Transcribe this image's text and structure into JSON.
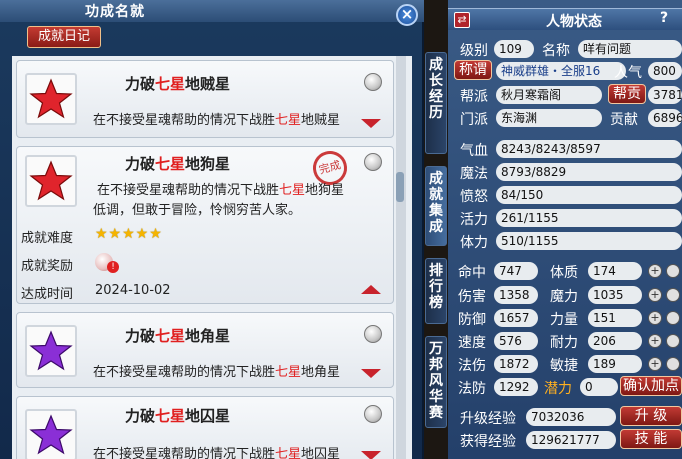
{
  "left_panel": {
    "title": "功成名就",
    "diary_button": "成就日记",
    "achievements": [
      {
        "title_pre": "力破",
        "title_red": "七星",
        "title_post": "地贼星",
        "desc_pre": "在不接受星魂帮助的情况下战胜",
        "desc_red": "七星",
        "desc_post": "地贼星",
        "star_color": "#e0242c"
      },
      {
        "title_pre": "力破",
        "title_red": "七星",
        "title_post": "地狗星",
        "desc_line1_pre": "在不接受星魂帮助的情况下战胜",
        "desc_line1_red": "七星",
        "desc_line1_post": "地狗星",
        "desc_line2": "低调，但敢于冒险，怜悯穷苦人家。",
        "difficulty_label": "成就难度",
        "difficulty_stars": "★★★★★",
        "reward_label": "成就奖励",
        "reward_badge": "!",
        "date_label": "达成时间",
        "date_value": "2024-10-02",
        "star_color": "#e0242c",
        "seal_text": "完成"
      },
      {
        "title_pre": "力破",
        "title_red": "七星",
        "title_post": "地角星",
        "desc_pre": "在不接受星魂帮助的情况下战胜",
        "desc_red": "七星",
        "desc_post": "地角星",
        "star_color": "#8a2fd6"
      },
      {
        "title_pre": "力破",
        "title_red": "七星",
        "title_post": "地囚星",
        "desc_pre": "在不接受星魂帮助的情况下战胜",
        "desc_red": "七星",
        "desc_post": "地囚星",
        "star_color": "#8a2fd6"
      }
    ]
  },
  "side_tabs": [
    "成长经历",
    "成就集成",
    "排行榜",
    "万邦风华赛"
  ],
  "right_panel": {
    "title": "人物状态",
    "help": "?",
    "level_label": "级别",
    "level": "109",
    "name_label": "名称",
    "name": "咩有问题",
    "title_button": "称谓",
    "title_value": "神威群雄・全服16",
    "renqi_label": "人气",
    "renqi": "800",
    "guild_label": "帮派",
    "guild": "秋月寒霜阁",
    "guild_contrib_button": "帮贡",
    "guild_contrib": "3781",
    "sect_label": "门派",
    "sect": "东海渊",
    "contrib_label": "贡献",
    "contrib": "6896",
    "hp_label": "气血",
    "hp": "8243/8243/8597",
    "mp_label": "魔法",
    "mp": "8793/8829",
    "anger_label": "愤怒",
    "anger": "84/150",
    "vitality_label": "活力",
    "vitality": "261/1155",
    "stamina_label": "体力",
    "stamina": "510/1155",
    "hit_label": "命中",
    "hit": "747",
    "con_label": "体质",
    "con": "174",
    "dmg_label": "伤害",
    "dmg": "1358",
    "mag_label": "魔力",
    "mag": "1035",
    "def_label": "防御",
    "def": "1657",
    "str_label": "力量",
    "str": "151",
    "spd_label": "速度",
    "spd": "576",
    "end_label": "耐力",
    "end": "206",
    "matk_label": "法伤",
    "matk": "1872",
    "agi_label": "敏捷",
    "agi": "189",
    "mdef_label": "法防",
    "mdef": "1292",
    "pot_label": "潜力",
    "pot": "0",
    "confirm_button": "确认加点",
    "exp_up_label": "升级经验",
    "exp_up": "7032036",
    "levelup_button": "升 级",
    "exp_got_label": "获得经验",
    "exp_got": "129621777",
    "skill_button": "技 能",
    "plus_symbol": "+"
  }
}
